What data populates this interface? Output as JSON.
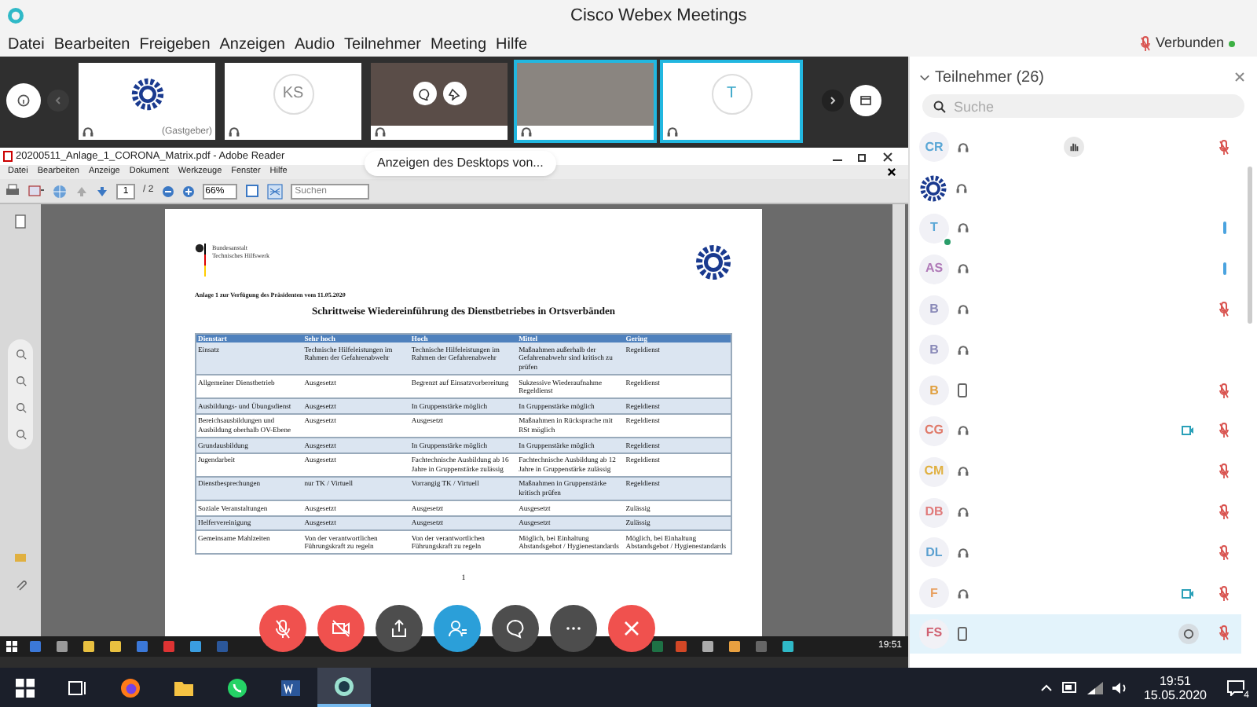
{
  "window": {
    "title": "Cisco Webex Meetings"
  },
  "menu": [
    "Datei",
    "Bearbeiten",
    "Freigeben",
    "Anzeigen",
    "Audio",
    "Teilnehmer",
    "Meeting",
    "Hilfe"
  ],
  "connection": {
    "label": "Verbunden",
    "connected": true
  },
  "video_strip": {
    "tiles": [
      {
        "kind": "logo",
        "label": "(Gastgeber)",
        "selected": false
      },
      {
        "kind": "initials",
        "initials": "KS",
        "selected": false
      },
      {
        "kind": "video",
        "controls": true,
        "selected": false
      },
      {
        "kind": "video",
        "controls": false,
        "selected": true
      },
      {
        "kind": "initials",
        "initials": "T",
        "selected": true
      }
    ]
  },
  "shared_screen": {
    "banner": "Anzeigen des Desktops von...",
    "reader": {
      "title": "20200511_Anlage_1_CORONA_Matrix.pdf - Adobe Reader",
      "menu": [
        "Datei",
        "Bearbeiten",
        "Anzeige",
        "Dokument",
        "Werkzeuge",
        "Fenster",
        "Hilfe"
      ],
      "page": "1",
      "page_count": "/ 2",
      "zoom": "66%",
      "search_placeholder": "Suchen"
    },
    "document": {
      "org_lines": [
        "Bundesanstalt",
        "Technisches Hilfswerk"
      ],
      "subtitle": "Anlage 1 zur Verfügung des Präsidenten vom 11.05.2020",
      "title": "Schrittweise Wiedereinführung des Dienstbetriebes in Ortsverbänden",
      "table": {
        "columns": [
          "Dienstart",
          "Sehr hoch",
          "Hoch",
          "Mittel",
          "Gering"
        ],
        "rows": [
          [
            "Einsatz",
            "Technische Hilfeleistungen im Rahmen der Gefahrenabwehr",
            "Technische Hilfeleistungen im Rahmen der Gefahrenabwehr",
            "Maßnahmen außerhalb der Gefahrenabwehr sind kritisch zu prüfen",
            "Regeldienst"
          ],
          [
            "Allgemeiner Dienstbetrieb",
            "Ausgesetzt",
            "Begrenzt auf Einsatzvorbereitung",
            "Sukzessive Wiederaufnahme Regeldienst",
            "Regeldienst"
          ],
          [
            "Ausbildungs- und Übungsdienst",
            "Ausgesetzt",
            "In Gruppenstärke möglich",
            "In Gruppenstärke möglich",
            "Regeldienst"
          ],
          [
            "Bereichsausbildungen und Ausbildung oberhalb OV-Ebene",
            "Ausgesetzt",
            "Ausgesetzt",
            "Maßnahmen in Rücksprache mit RSt möglich",
            "Regeldienst"
          ],
          [
            "Grundausbildung",
            "Ausgesetzt",
            "In Gruppenstärke möglich",
            "In Gruppenstärke möglich",
            "Regeldienst"
          ],
          [
            "Jugendarbeit",
            "Ausgesetzt",
            "Fachtechnische Ausbildung ab 16 Jahre in Gruppenstärke zulässig",
            "Fachtechnische Ausbildung ab 12 Jahre in Gruppenstärke zulässig",
            "Regeldienst"
          ],
          [
            "Dienstbesprechungen",
            "nur TK / Virtuell",
            "Vorrangig TK / Virtuell",
            "Maßnahmen in Gruppenstärke kritisch prüfen",
            "Regeldienst"
          ],
          [
            "Soziale Veranstaltungen",
            "Ausgesetzt",
            "Ausgesetzt",
            "Ausgesetzt",
            "Zulässig"
          ],
          [
            "Helfervereinigung",
            "Ausgesetzt",
            "Ausgesetzt",
            "Ausgesetzt",
            "Zulässig"
          ],
          [
            "Gemeinsame Mahlzeiten",
            "Von der verantwortlichen Führungskraft zu regeln",
            "Von der verantwortlichen Führungskraft zu regeln",
            "Möglich, bei Einhaltung Abstandsgebot / Hygienestandards",
            "Möglich, bei Einhaltung Abstandsgebot / Hygienestandards"
          ]
        ]
      },
      "page_number": "1"
    },
    "taskbar_clock": "19:51"
  },
  "call_controls": [
    {
      "kind": "mute"
    },
    {
      "kind": "video_off"
    },
    {
      "kind": "share"
    },
    {
      "kind": "participants"
    },
    {
      "kind": "chat"
    },
    {
      "kind": "more"
    },
    {
      "kind": "leave"
    }
  ],
  "participants_panel": {
    "title": "Teilnehmer (26)",
    "search_placeholder": "Suche",
    "participants": [
      {
        "kind": "initials",
        "initials": "CR",
        "color": "#5aa7d6",
        "phone": false,
        "hand": true,
        "video": false,
        "chat": false,
        "muted": true,
        "speaking": false,
        "presence": false,
        "selected": false
      },
      {
        "kind": "logo",
        "phone": false,
        "hand": false,
        "video": false,
        "chat": false,
        "muted": false,
        "speaking": false,
        "selected": false
      },
      {
        "kind": "initials",
        "initials": "T",
        "color": "#5aa7d6",
        "phone": false,
        "hand": false,
        "video": false,
        "chat": false,
        "muted": false,
        "speaking": true,
        "presence": true,
        "selected": false
      },
      {
        "kind": "initials",
        "initials": "AS",
        "color": "#b07ab8",
        "phone": false,
        "hand": false,
        "video": false,
        "chat": false,
        "muted": false,
        "speaking": true,
        "presence": false,
        "selected": false
      },
      {
        "kind": "initials",
        "initials": "B",
        "color": "#8a8ab8",
        "phone": false,
        "hand": false,
        "video": false,
        "chat": false,
        "muted": true,
        "speaking": false,
        "presence": false,
        "selected": false
      },
      {
        "kind": "initials",
        "initials": "B",
        "color": "#8a8ab8",
        "phone": false,
        "hand": false,
        "video": false,
        "chat": false,
        "muted": false,
        "speaking": false,
        "presence": false,
        "selected": false
      },
      {
        "kind": "initials",
        "initials": "B",
        "color": "#e0a040",
        "phone": true,
        "hand": false,
        "video": false,
        "chat": false,
        "muted": true,
        "speaking": false,
        "presence": false,
        "selected": false
      },
      {
        "kind": "initials",
        "initials": "CG",
        "color": "#e07a6a",
        "phone": false,
        "hand": false,
        "video": true,
        "chat": false,
        "muted": true,
        "speaking": false,
        "presence": false,
        "selected": false
      },
      {
        "kind": "initials",
        "initials": "CM",
        "color": "#e0b040",
        "phone": false,
        "hand": false,
        "video": false,
        "chat": false,
        "muted": true,
        "speaking": false,
        "presence": false,
        "selected": false
      },
      {
        "kind": "initials",
        "initials": "DB",
        "color": "#e07a7a",
        "phone": false,
        "hand": false,
        "video": false,
        "chat": false,
        "muted": true,
        "speaking": false,
        "presence": false,
        "selected": false
      },
      {
        "kind": "initials",
        "initials": "DL",
        "color": "#5aa0d0",
        "phone": false,
        "hand": false,
        "video": false,
        "chat": false,
        "muted": true,
        "speaking": false,
        "presence": false,
        "selected": false
      },
      {
        "kind": "initials",
        "initials": "F",
        "color": "#e8a060",
        "phone": false,
        "hand": false,
        "video": true,
        "chat": false,
        "muted": true,
        "speaking": false,
        "presence": false,
        "selected": false
      },
      {
        "kind": "initials",
        "initials": "FS",
        "color": "#d06070",
        "phone": true,
        "hand": false,
        "video": false,
        "chat": true,
        "muted": true,
        "speaking": false,
        "presence": false,
        "selected": true
      }
    ]
  },
  "taskbar": {
    "apps": [
      {
        "kind": "taskview",
        "selected": false
      },
      {
        "kind": "firefox",
        "selected": false
      },
      {
        "kind": "explorer",
        "selected": false
      },
      {
        "kind": "whatsapp",
        "selected": false
      },
      {
        "kind": "word",
        "selected": false
      },
      {
        "kind": "webex",
        "selected": true
      }
    ],
    "time": "19:51",
    "date": "15.05.2020",
    "notifications": "4"
  }
}
